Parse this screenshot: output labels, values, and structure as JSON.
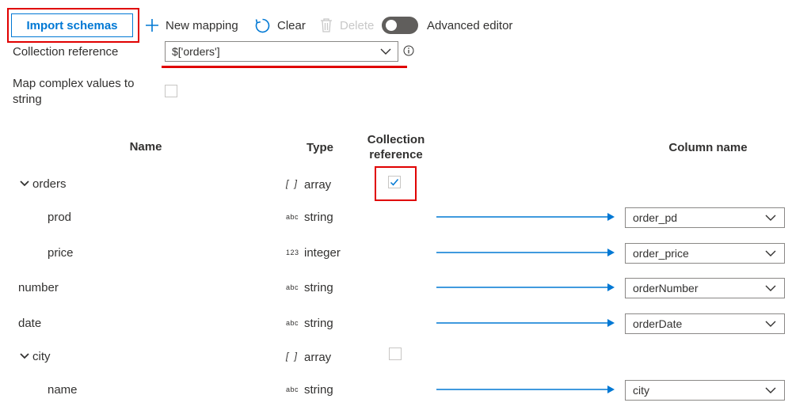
{
  "toolbar": {
    "import_label": "Import schemas",
    "new_mapping_label": "New mapping",
    "clear_label": "Clear",
    "delete_label": "Delete",
    "advanced_editor_label": "Advanced editor",
    "advanced_editor_on": false
  },
  "form": {
    "collection_reference_label": "Collection reference",
    "collection_reference_value": "$['orders']",
    "map_complex_label_line1": "Map complex values to",
    "map_complex_label_line2": "string",
    "map_complex_checked": false
  },
  "table": {
    "headers": {
      "name": "Name",
      "type": "Type",
      "collection_line1": "Collection",
      "collection_line2": "reference",
      "column": "Column name"
    },
    "rows": [
      {
        "name": "orders",
        "type_glyph": "[ ]",
        "type": "array",
        "expandable": true,
        "collection_ref": true,
        "collection_checked": true,
        "column": ""
      },
      {
        "name": "prod",
        "type_glyph": "abc",
        "type": "string",
        "column": "order_pd"
      },
      {
        "name": "price",
        "type_glyph": "123",
        "type": "integer",
        "column": "order_price"
      },
      {
        "name": "number",
        "type_glyph": "abc",
        "type": "string",
        "column": "orderNumber"
      },
      {
        "name": "date",
        "type_glyph": "abc",
        "type": "string",
        "column": "orderDate"
      },
      {
        "name": "city",
        "type_glyph": "[ ]",
        "type": "array",
        "expandable": true,
        "collection_ref": true,
        "collection_checked": false,
        "column": ""
      },
      {
        "name": "name",
        "type_glyph": "abc",
        "type": "string",
        "column": "city"
      }
    ]
  },
  "colors": {
    "accent": "#0078d4",
    "highlight": "#e00000",
    "arrow": "#0078d4"
  }
}
